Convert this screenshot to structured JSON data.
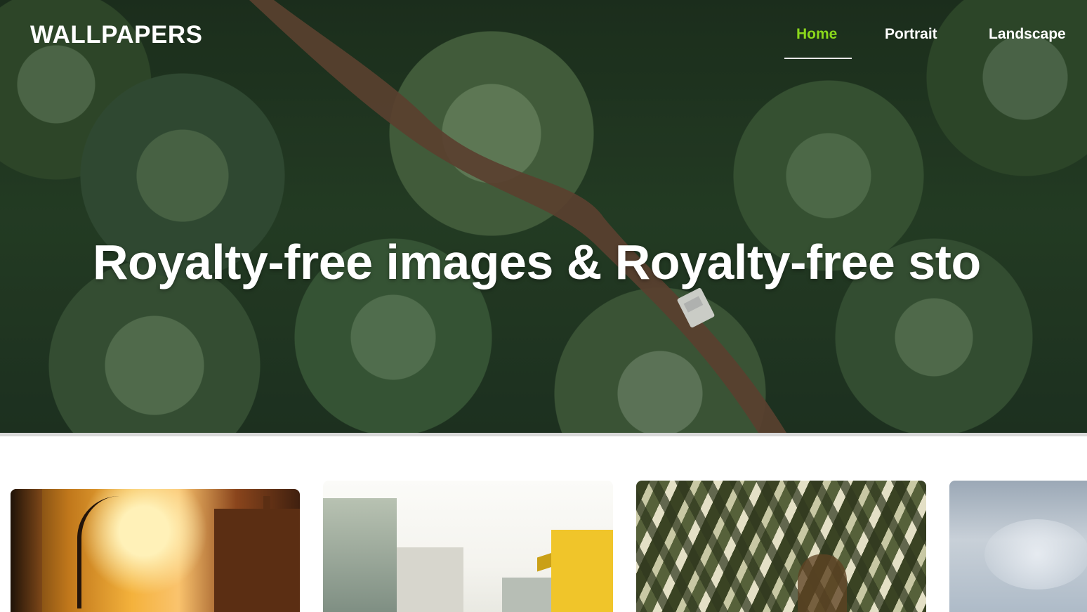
{
  "brand": {
    "logo_text": "WALLPAPERS"
  },
  "nav": {
    "items": [
      {
        "label": "Home",
        "active": true
      },
      {
        "label": "Portrait",
        "active": false
      },
      {
        "label": "Landscape",
        "active": false
      }
    ]
  },
  "hero": {
    "title": "Royalty-free images & Royalty-free sto"
  },
  "theme": {
    "active_nav_color": "#8bd81b",
    "hero_text_color": "#ffffff"
  }
}
